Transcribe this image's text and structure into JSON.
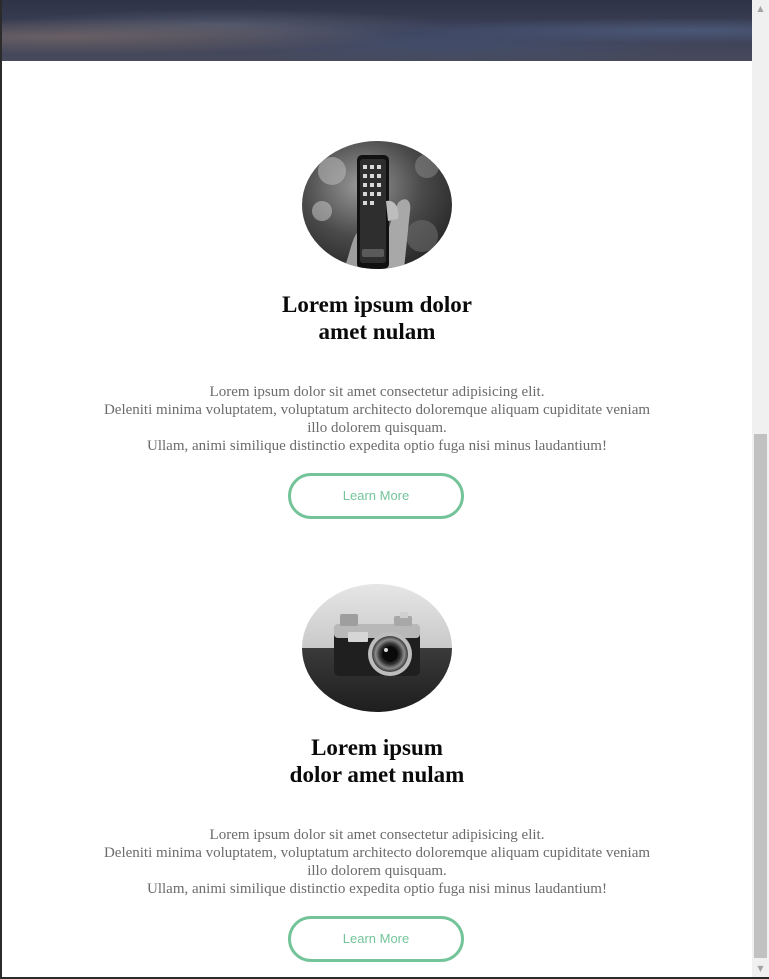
{
  "cards": [
    {
      "image": "smartphone-in-hand-photo",
      "title_lines": [
        "Lorem ipsum dolor",
        "amet nulam"
      ],
      "text_lines": [
        "Lorem ipsum dolor sit amet consectetur adipisicing elit.",
        "Deleniti minima voluptatem, voluptatum architecto doloremque aliquam cupiditate veniam",
        "illo dolorem quisquam.",
        "Ullam, animi similique distinctio expedita optio fuga nisi minus laudantium!"
      ],
      "button_label": "Learn More"
    },
    {
      "image": "camera-photo",
      "title_lines": [
        "Lorem ipsum",
        "dolor amet nulam"
      ],
      "text_lines": [
        "Lorem ipsum dolor sit amet consectetur adipisicing elit.",
        "Deleniti minima voluptatem, voluptatum architecto doloremque aliquam cupiditate veniam",
        "illo dolorem quisquam.",
        "Ullam, animi similique distinctio expedita optio fuga nisi minus laudantium!"
      ],
      "button_label": "Learn More"
    }
  ],
  "scrollbar": {
    "up_icon": "scroll-up-arrow-icon",
    "down_icon": "scroll-down-arrow-icon",
    "up_glyph": "▲",
    "down_glyph": "▼"
  },
  "colors": {
    "accent": "#74c49a",
    "body_text": "#6b6b6b",
    "title_text": "#0a0a0a",
    "hero_overlay": "#3c4158"
  }
}
